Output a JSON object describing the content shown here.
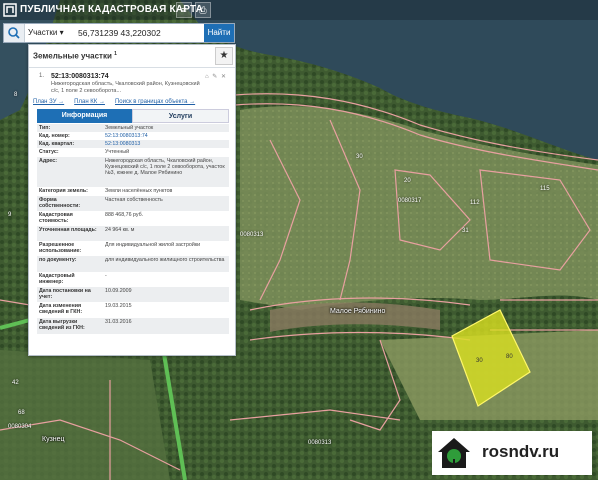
{
  "app": {
    "title": "ПУБЛИЧНАЯ КАДАСТРОВАЯ КАРТА"
  },
  "search": {
    "type_label": "Участки",
    "query": "56,731239 43,220302",
    "button_label": "Найти"
  },
  "panel": {
    "title": "Земельные участки",
    "title_count": "1",
    "result": {
      "index": "1.",
      "cadnum": "52:13:0080313:74",
      "address_short": "Нижегородская область, Чкаловский район, Кузнецовский с/с, 1 поле 2 севооборота...",
      "links": [
        "План ЗУ →",
        "План КК →",
        "Поиск в границах объекта →"
      ]
    },
    "tabs": [
      "Информация",
      "Услуги"
    ],
    "info_rows": [
      {
        "key": "Тип:",
        "value": "Земельный участок"
      },
      {
        "key": "Кад. номер:",
        "value": "52:13:0080313:74"
      },
      {
        "key": "Кад. квартал:",
        "value": "52:13:0080313"
      },
      {
        "key": "Статус:",
        "value": "Учтенный"
      },
      {
        "key": "Адрес:",
        "value": "Нижегородская область, Чкаловский район, Кузнецовский с/с, 1 поле 2 севооборота, участок №3, южнее д. Малое Рябинино"
      },
      {
        "key": "Категория земель:",
        "value": "Земли населённых пунктов"
      },
      {
        "key": "Форма собственности:",
        "value": "Частная собственность"
      },
      {
        "key": "Кадастровая стоимость:",
        "value": "888 468,76 руб."
      },
      {
        "key": "Уточненная площадь:",
        "value": "24 964 кв. м"
      },
      {
        "key": "Разрешенное использование:",
        "value": "Для индивидуальной жилой застройки"
      },
      {
        "key": "по документу:",
        "value": "для индивидуального жилищного строительства"
      },
      {
        "key": "Кадастровый инженер:",
        "value": "-"
      },
      {
        "key": "Дата постановки на учет:",
        "value": "10.09.2009"
      },
      {
        "key": "Дата изменения сведений в ГКН:",
        "value": "19.03.2015"
      },
      {
        "key": "Дата выгрузки сведений из ГКН:",
        "value": "31.03.2016"
      }
    ]
  },
  "map": {
    "labels": [
      "8",
      "9",
      "20",
      "30",
      "31",
      "112",
      "115",
      "42",
      "68",
      "0080317",
      "0080313",
      "0080304",
      "0080313"
    ],
    "village": "Малое Рябинино",
    "village2": "Кузнец",
    "selected_label_a": "30",
    "selected_label_b": "80"
  },
  "watermark": {
    "text": "rosndv.ru"
  },
  "colors": {
    "accent": "#1e6fb5",
    "parcel_border": "#e8a0a0",
    "selected_fill": "#d9e020",
    "water": "#2f4a5a"
  }
}
